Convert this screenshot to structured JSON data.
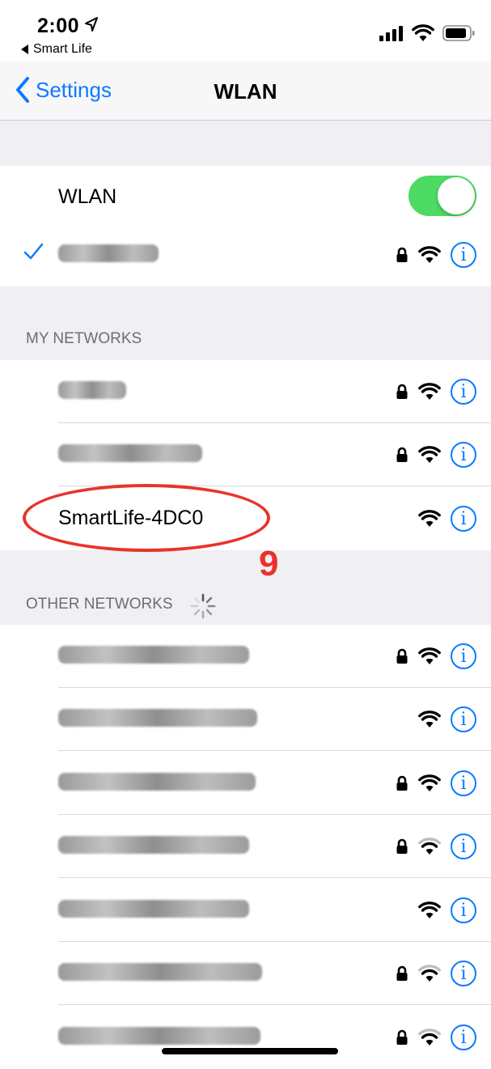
{
  "status_bar": {
    "time": "2:00",
    "back_app": "Smart Life"
  },
  "nav": {
    "back_label": "Settings",
    "title": "WLAN"
  },
  "wlan_toggle": {
    "label": "WLAN",
    "on": true
  },
  "connected_network": {
    "name_obscured": true,
    "secured": true,
    "checked": true
  },
  "sections": {
    "my_networks": "MY NETWORKS",
    "other_networks": "OTHER NETWORKS"
  },
  "my_networks": [
    {
      "name_obscured": true,
      "secured": true
    },
    {
      "name_obscured": true,
      "secured": true
    },
    {
      "name": "SmartLife-4DC0",
      "secured": false
    }
  ],
  "other_networks": [
    {
      "name_obscured": true,
      "secured": true
    },
    {
      "name_obscured": true,
      "secured": false
    },
    {
      "name_obscured": true,
      "secured": true
    },
    {
      "name_obscured": true,
      "secured": true,
      "weak_signal": true
    },
    {
      "name_obscured": true,
      "secured": false
    },
    {
      "name_obscured": true,
      "secured": true,
      "weak_signal": true
    },
    {
      "name_obscured": true,
      "secured": true,
      "weak_signal": true
    }
  ],
  "annotation": {
    "step": "9"
  },
  "colors": {
    "accent": "#0a7aff",
    "toggle_on": "#4cd964",
    "annotation": "#e8342a"
  }
}
